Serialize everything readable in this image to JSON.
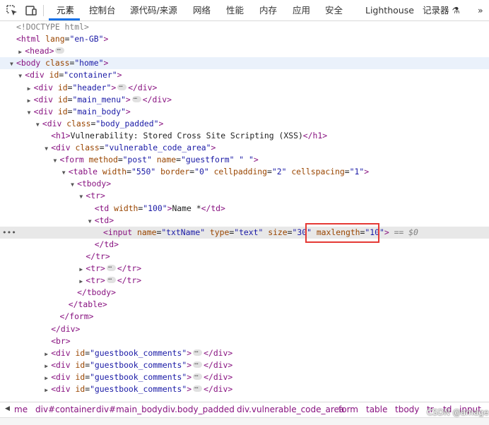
{
  "toolbar": {
    "tabs": [
      "元素",
      "控制台",
      "源代码/来源",
      "网络",
      "性能",
      "内存",
      "应用",
      "安全",
      "Lighthouse",
      "记录器 ⚗",
      "»"
    ],
    "active_tab": "元素"
  },
  "tree": {
    "lines": [
      {
        "text": "<!DOCTYPE html>"
      },
      {
        "open": "html",
        "attrs": [
          {
            "n": "lang",
            "v": "en-GB"
          }
        ]
      },
      {
        "open": "head"
      },
      {
        "open": "body",
        "attrs": [
          {
            "n": "class",
            "v": "home"
          }
        ]
      },
      {
        "open": "div",
        "attrs": [
          {
            "n": "id",
            "v": "container"
          }
        ]
      },
      {
        "open": "div",
        "attrs": [
          {
            "n": "id",
            "v": "header"
          }
        ],
        "close": "div"
      },
      {
        "open": "div",
        "attrs": [
          {
            "n": "id",
            "v": "main_menu"
          }
        ],
        "close": "div"
      },
      {
        "open": "div",
        "attrs": [
          {
            "n": "id",
            "v": "main_body"
          }
        ]
      },
      {
        "open": "div",
        "attrs": [
          {
            "n": "class",
            "v": "body_padded"
          }
        ]
      },
      {
        "open": "h1",
        "content": "Vulnerability: Stored Cross Site Scripting (XSS)",
        "close": "h1"
      },
      {
        "open": "div",
        "attrs": [
          {
            "n": "class",
            "v": "vulnerable_code_area"
          }
        ]
      },
      {
        "open": "form",
        "attrs": [
          {
            "n": "method",
            "v": "post"
          },
          {
            "n": "name",
            "v": "guestform"
          },
          {
            "n": "",
            "v": " "
          }
        ]
      },
      {
        "open": "table",
        "attrs": [
          {
            "n": "width",
            "v": "550"
          },
          {
            "n": "border",
            "v": "0"
          },
          {
            "n": "cellpadding",
            "v": "2"
          },
          {
            "n": "cellspacing",
            "v": "1"
          }
        ]
      },
      {
        "open": "tbody"
      },
      {
        "open": "tr"
      },
      {
        "open": "td",
        "attrs": [
          {
            "n": "width",
            "v": "100"
          }
        ],
        "content": "Name *",
        "close": "td"
      },
      {
        "open": "td"
      },
      {
        "open": "input",
        "attrs": [
          {
            "n": "name",
            "v": "txtName"
          },
          {
            "n": "type",
            "v": "text"
          },
          {
            "n": "size",
            "v": "30"
          },
          {
            "n": "maxlength",
            "v": "10"
          }
        ],
        "suffix": "== $0"
      },
      {
        "close": "td"
      },
      {
        "close": "tr"
      },
      {
        "open": "tr",
        "close": "tr"
      },
      {
        "open": "tr",
        "close": "tr"
      },
      {
        "close": "tbody"
      },
      {
        "close": "table"
      },
      {
        "close": "form"
      },
      {
        "close": "div"
      },
      {
        "open": "br"
      },
      {
        "open": "div",
        "attrs": [
          {
            "n": "id",
            "v": "guestbook_comments"
          }
        ],
        "close": "div"
      },
      {
        "open": "div",
        "attrs": [
          {
            "n": "id",
            "v": "guestbook_comments"
          }
        ],
        "close": "div"
      },
      {
        "open": "div",
        "attrs": [
          {
            "n": "id",
            "v": "guestbook_comments"
          }
        ],
        "close": "div"
      },
      {
        "open": "div",
        "attrs": [
          {
            "n": "id",
            "v": "guestbook_comments"
          }
        ],
        "close": "div"
      }
    ]
  },
  "breadcrumbs": [
    "me",
    "div#container",
    "div#main_body",
    "div.body_padded",
    "div.vulnerable_code_area",
    "form",
    "table",
    "tbody",
    "tr",
    "td",
    "input"
  ],
  "watermark": "CSDN @amage",
  "colors": {
    "tag": "#881280",
    "attr_name": "#994500",
    "attr_value": "#1a1aa6",
    "highlight_box": "#e53935",
    "active_tab_underline": "#1a73e8"
  }
}
